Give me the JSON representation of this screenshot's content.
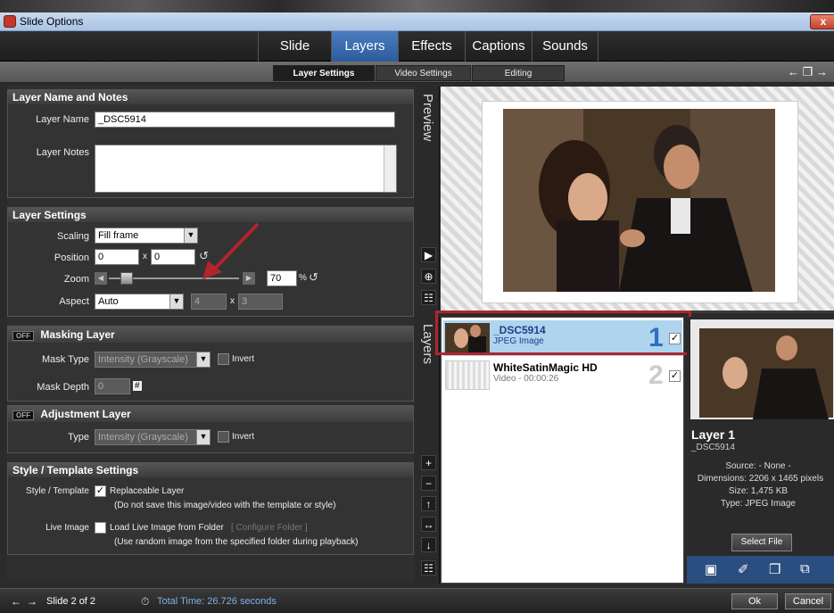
{
  "window": {
    "title": "Slide Options",
    "close": "x"
  },
  "main_tabs": [
    "Slide",
    "Layers",
    "Effects",
    "Captions",
    "Sounds"
  ],
  "active_main_tab": "Layers",
  "sub_tabs": [
    "Layer Settings",
    "Video Settings",
    "Editing"
  ],
  "active_sub_tab": "Layer Settings",
  "name_notes": {
    "header": "Layer Name and Notes",
    "name_label": "Layer Name",
    "name_value": "_DSC5914",
    "notes_label": "Layer Notes",
    "notes_value": ""
  },
  "layer_settings": {
    "header": "Layer Settings",
    "scaling_label": "Scaling",
    "scaling_value": "Fill frame",
    "position_label": "Position",
    "position_x": "0",
    "position_y": "0",
    "x_sep": "x",
    "zoom_label": "Zoom",
    "zoom_value": "70",
    "zoom_level": 0.1,
    "percent": "%",
    "aspect_label": "Aspect",
    "aspect_value": "Auto",
    "aspect_w": "4",
    "aspect_h": "3"
  },
  "masking": {
    "toggle": "OFF",
    "header": "Masking Layer",
    "type_label": "Mask Type",
    "type_value": "Intensity (Grayscale)",
    "invert_label": "Invert",
    "depth_label": "Mask Depth",
    "depth_value": "0",
    "depth_suffix": "#"
  },
  "adjustment": {
    "toggle": "OFF",
    "header": "Adjustment Layer",
    "type_label": "Type",
    "type_value": "Intensity (Grayscale)",
    "invert_label": "Invert"
  },
  "style": {
    "header": "Style / Template Settings",
    "template_label": "Style / Template",
    "replaceable_label": "Replaceable Layer",
    "replaceable_note": "(Do not save this image/video with the template or style)",
    "live_label": "Live Image",
    "live_option": "Load Live Image from Folder",
    "configure_link": "[ Configure Folder ]",
    "live_note": "(Use random image from the specified folder during playback)"
  },
  "preview_tab": "Preview",
  "layers_tab": "Layers",
  "layers": [
    {
      "name": "_DSC5914",
      "type": "JPEG Image",
      "number": "1",
      "checked": true
    },
    {
      "name": "WhiteSatinMagic HD",
      "type": "Video - 00:00:26",
      "number": "2",
      "checked": true
    }
  ],
  "layer_info": {
    "title": "Layer 1",
    "name": "_DSC5914",
    "source": "Source:  - None -",
    "dimensions": "Dimensions: 2206 x 1465 pixels",
    "size": "Size: 1,475 KB",
    "type": "Type: JPEG Image",
    "select_file": "Select File"
  },
  "footer": {
    "slide": "Slide 2 of 2",
    "total_time": "Total Time: 26.726 seconds",
    "ok": "Ok",
    "cancel": "Cancel"
  },
  "colors": {
    "accent": "#3a6fb5",
    "highlight": "#aed4ee",
    "red_box": "#b0242c",
    "arrow": "#b0242c"
  }
}
